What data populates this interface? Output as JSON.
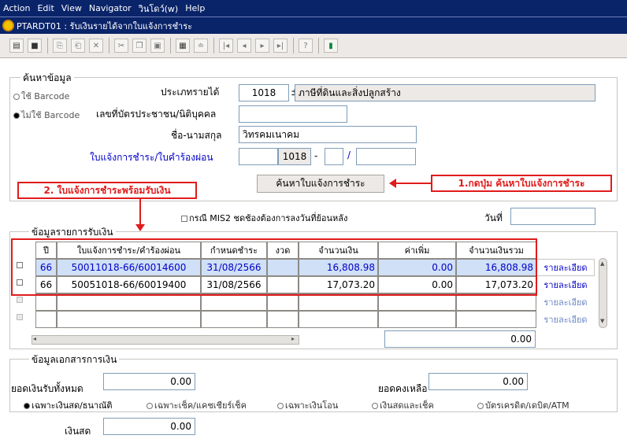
{
  "menu": [
    "Action",
    "Edit",
    "View",
    "Navigator",
    "วินโดว์(w)",
    "Help"
  ],
  "window_title": "PTARDT01 : รับเงินรายได้จากใบแจ้งการชำระ",
  "search": {
    "legend": "ค้นหาข้อมูล",
    "use_barcode": "ใช้ Barcode",
    "no_barcode": "ไม่ใช้ Barcode",
    "income_type_label": "ประเภทรายได้",
    "income_type_code": "1018",
    "income_type_name": "ภาษีที่ดินและสิ่งปลูกสร้าง",
    "id_label": "เลขที่บัตรประชาชน/นิติบุคคล",
    "id_value": "",
    "name_label": "ชื่อ-นามสกุล",
    "name_value": "วิทรคมเนาคม",
    "notice_label": "ใบแจ้งการชำระ/ใบคำร้องผ่อน",
    "notice_part1": "",
    "notice_part2": "1018",
    "notice_dash": "-",
    "notice_part3": "",
    "notice_slash": "/",
    "notice_part4": "",
    "search_button": "ค้นหาใบแจ้งการชำระ"
  },
  "annotations": {
    "step1": "1.กดปุ่ม ค้นหาใบแจ้งการชำระ",
    "step2": "2. ใบแจ้งการชำระพร้อมรับเงิน"
  },
  "mis2_label": "กรณี MIS2 ชดช้องต้องการลงวันที่ย้อนหลัง",
  "date_label": "วันที่",
  "date_value": "",
  "receipt": {
    "legend": "ข้อมูลรายการรับเงิน",
    "headers": [
      "ปี",
      "ใบแจ้งการชำระ/คำร้องผ่อน",
      "กำหนดชำระ",
      "งวด",
      "จำนวนเงิน",
      "ค่าเพิ่ม",
      "จำนวนเงินรวม"
    ],
    "rows": [
      {
        "year": "66",
        "notice": "50011018-66/60014600",
        "due": "31/08/2566",
        "installment": "",
        "amount": "16,808.98",
        "extra": "0.00",
        "total": "16,808.98",
        "detail": "รายละเอียด"
      },
      {
        "year": "66",
        "notice": "50051018-66/60019400",
        "due": "31/08/2566",
        "installment": "",
        "amount": "17,073.20",
        "extra": "0.00",
        "total": "17,073.20",
        "detail": "รายละเอียด"
      },
      {
        "year": "",
        "notice": "",
        "due": "",
        "installment": "",
        "amount": "",
        "extra": "",
        "total": "",
        "detail": "รายละเอียด"
      },
      {
        "year": "",
        "notice": "",
        "due": "",
        "installment": "",
        "amount": "",
        "extra": "",
        "total": "",
        "detail": "รายละเอียด"
      }
    ],
    "sum_total": "0.00"
  },
  "docs": {
    "legend": "ข้อมูลเอกสารการเงิน",
    "total_label": "ยอดเงินรับทั้งหมด",
    "total_value": "0.00",
    "balance_label": "ยอดคงเหลือ",
    "balance_value": "0.00",
    "pay_options": [
      "เฉพาะเงินสด/ธนาณัติ",
      "เฉพาะเช็ค/แคชเชียร์เช็ค",
      "เฉพาะเงินโอน",
      "เงินสดและเช็ค",
      "บัตรเครดิต/เดบิต/ATM"
    ],
    "cash_label": "เงินสด",
    "cash_value": "0.00"
  },
  "colors": {
    "red": "#e11b1b",
    "selected_row": "#cfe0f7",
    "title_bar": "#0a246a"
  }
}
